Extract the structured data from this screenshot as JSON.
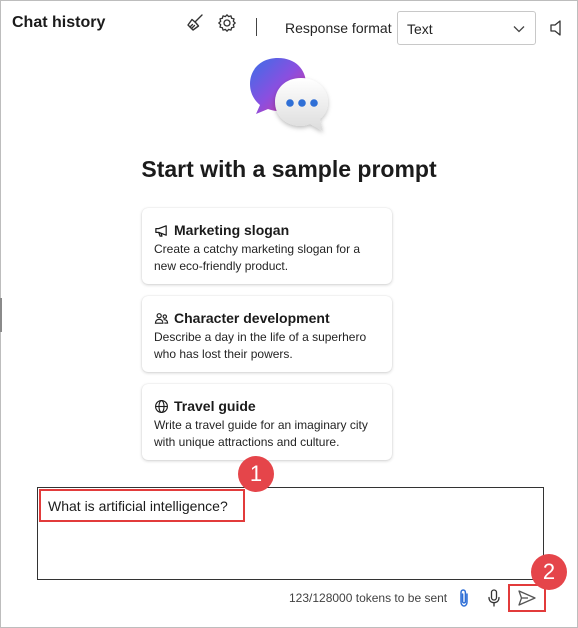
{
  "header": {
    "title": "Chat history",
    "clear_icon": "broom-icon",
    "settings_icon": "gear-icon",
    "response_format_label": "Response format",
    "response_format_value": "Text",
    "speaker_icon": "speaker-icon"
  },
  "hero": {
    "logo_icon": "chat-bubbles-logo",
    "title": "Start with a sample prompt"
  },
  "prompts": [
    {
      "icon": "megaphone-icon",
      "title": "Marketing slogan",
      "description": "Create a catchy marketing slogan for a new eco-friendly product."
    },
    {
      "icon": "people-icon",
      "title": "Character development",
      "description": "Describe a day in the life of a superhero who has lost their powers."
    },
    {
      "icon": "globe-icon",
      "title": "Travel guide",
      "description": "Write a travel guide for an imaginary city with unique attractions and culture."
    }
  ],
  "input": {
    "value": "What is artificial intelligence?"
  },
  "footer": {
    "token_count": "123/128000 tokens to be sent",
    "attach_icon": "paperclip-icon",
    "mic_icon": "microphone-icon",
    "send_icon": "send-icon"
  },
  "annotations": {
    "badge_1": "1",
    "badge_2": "2"
  },
  "colors": {
    "annotation_red": "#e5454a",
    "highlight_border": "#e23b3b",
    "accent_blue": "#2f6fd6"
  }
}
